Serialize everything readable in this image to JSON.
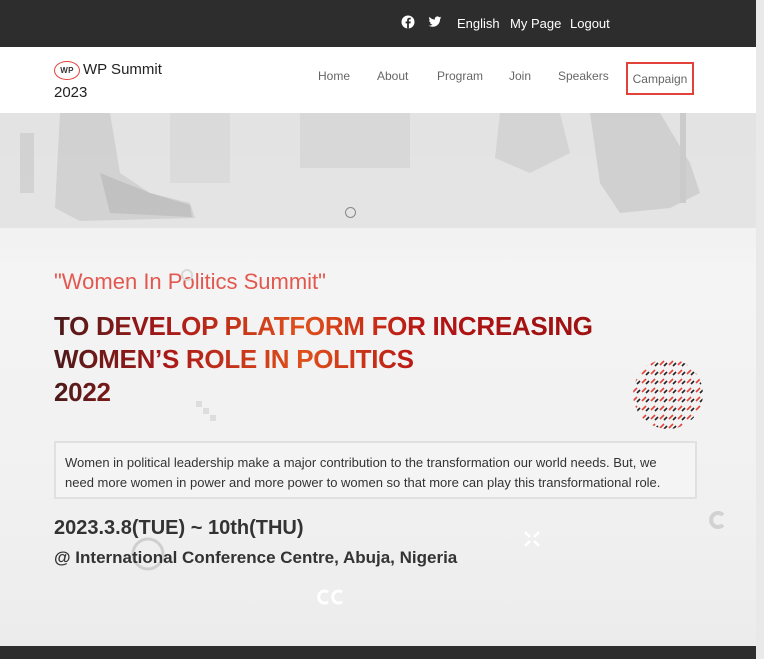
{
  "topbar": {
    "icons": [
      "facebook-icon",
      "twitter-icon"
    ],
    "language": "English",
    "mypage": "My Page",
    "logout": "Logout"
  },
  "header": {
    "logo_badge": "WP",
    "logo_text": "WP Summit",
    "logo_year": "2023",
    "nav": [
      "Home",
      "About",
      "Program",
      "Join",
      "Speakers",
      "Campaign"
    ],
    "highlighted_nav": "Campaign"
  },
  "hero": {
    "subtitle": "\"Women In Politics Summit\"",
    "headline": [
      "TO DEVELOP PLATFORM FOR INCREASING",
      "WOMEN’S ROLE IN POLITICS",
      "2022"
    ],
    "description": "Women in political leadership make a major contribution to the transformation our world needs. But, we need more women in power and more power to women so that more can play this transformational role.",
    "date": "2023.3.8(TUE) ~ 10th(THU)",
    "venue": "@ International Conference Centre, Abuja, Nigeria"
  },
  "colors": {
    "accent": "#e2423a",
    "topbar_bg": "#2d2d2d",
    "headline_dark": "#a81818",
    "headline_orange": "#e0501c"
  }
}
